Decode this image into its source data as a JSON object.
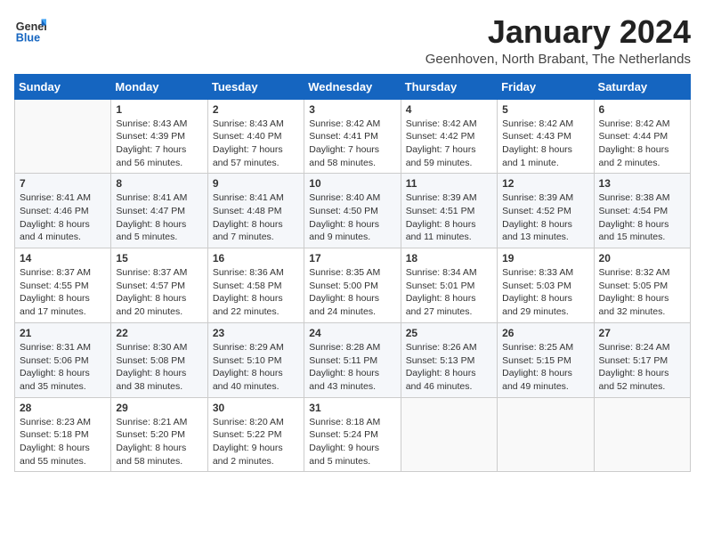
{
  "logo": {
    "line1": "General",
    "line2": "Blue"
  },
  "title": "January 2024",
  "subtitle": "Geenhoven, North Brabant, The Netherlands",
  "days_of_week": [
    "Sunday",
    "Monday",
    "Tuesday",
    "Wednesday",
    "Thursday",
    "Friday",
    "Saturday"
  ],
  "weeks": [
    [
      {
        "day": "",
        "info": ""
      },
      {
        "day": "1",
        "info": "Sunrise: 8:43 AM\nSunset: 4:39 PM\nDaylight: 7 hours\nand 56 minutes."
      },
      {
        "day": "2",
        "info": "Sunrise: 8:43 AM\nSunset: 4:40 PM\nDaylight: 7 hours\nand 57 minutes."
      },
      {
        "day": "3",
        "info": "Sunrise: 8:42 AM\nSunset: 4:41 PM\nDaylight: 7 hours\nand 58 minutes."
      },
      {
        "day": "4",
        "info": "Sunrise: 8:42 AM\nSunset: 4:42 PM\nDaylight: 7 hours\nand 59 minutes."
      },
      {
        "day": "5",
        "info": "Sunrise: 8:42 AM\nSunset: 4:43 PM\nDaylight: 8 hours\nand 1 minute."
      },
      {
        "day": "6",
        "info": "Sunrise: 8:42 AM\nSunset: 4:44 PM\nDaylight: 8 hours\nand 2 minutes."
      }
    ],
    [
      {
        "day": "7",
        "info": "Sunrise: 8:41 AM\nSunset: 4:46 PM\nDaylight: 8 hours\nand 4 minutes."
      },
      {
        "day": "8",
        "info": "Sunrise: 8:41 AM\nSunset: 4:47 PM\nDaylight: 8 hours\nand 5 minutes."
      },
      {
        "day": "9",
        "info": "Sunrise: 8:41 AM\nSunset: 4:48 PM\nDaylight: 8 hours\nand 7 minutes."
      },
      {
        "day": "10",
        "info": "Sunrise: 8:40 AM\nSunset: 4:50 PM\nDaylight: 8 hours\nand 9 minutes."
      },
      {
        "day": "11",
        "info": "Sunrise: 8:39 AM\nSunset: 4:51 PM\nDaylight: 8 hours\nand 11 minutes."
      },
      {
        "day": "12",
        "info": "Sunrise: 8:39 AM\nSunset: 4:52 PM\nDaylight: 8 hours\nand 13 minutes."
      },
      {
        "day": "13",
        "info": "Sunrise: 8:38 AM\nSunset: 4:54 PM\nDaylight: 8 hours\nand 15 minutes."
      }
    ],
    [
      {
        "day": "14",
        "info": "Sunrise: 8:37 AM\nSunset: 4:55 PM\nDaylight: 8 hours\nand 17 minutes."
      },
      {
        "day": "15",
        "info": "Sunrise: 8:37 AM\nSunset: 4:57 PM\nDaylight: 8 hours\nand 20 minutes."
      },
      {
        "day": "16",
        "info": "Sunrise: 8:36 AM\nSunset: 4:58 PM\nDaylight: 8 hours\nand 22 minutes."
      },
      {
        "day": "17",
        "info": "Sunrise: 8:35 AM\nSunset: 5:00 PM\nDaylight: 8 hours\nand 24 minutes."
      },
      {
        "day": "18",
        "info": "Sunrise: 8:34 AM\nSunset: 5:01 PM\nDaylight: 8 hours\nand 27 minutes."
      },
      {
        "day": "19",
        "info": "Sunrise: 8:33 AM\nSunset: 5:03 PM\nDaylight: 8 hours\nand 29 minutes."
      },
      {
        "day": "20",
        "info": "Sunrise: 8:32 AM\nSunset: 5:05 PM\nDaylight: 8 hours\nand 32 minutes."
      }
    ],
    [
      {
        "day": "21",
        "info": "Sunrise: 8:31 AM\nSunset: 5:06 PM\nDaylight: 8 hours\nand 35 minutes."
      },
      {
        "day": "22",
        "info": "Sunrise: 8:30 AM\nSunset: 5:08 PM\nDaylight: 8 hours\nand 38 minutes."
      },
      {
        "day": "23",
        "info": "Sunrise: 8:29 AM\nSunset: 5:10 PM\nDaylight: 8 hours\nand 40 minutes."
      },
      {
        "day": "24",
        "info": "Sunrise: 8:28 AM\nSunset: 5:11 PM\nDaylight: 8 hours\nand 43 minutes."
      },
      {
        "day": "25",
        "info": "Sunrise: 8:26 AM\nSunset: 5:13 PM\nDaylight: 8 hours\nand 46 minutes."
      },
      {
        "day": "26",
        "info": "Sunrise: 8:25 AM\nSunset: 5:15 PM\nDaylight: 8 hours\nand 49 minutes."
      },
      {
        "day": "27",
        "info": "Sunrise: 8:24 AM\nSunset: 5:17 PM\nDaylight: 8 hours\nand 52 minutes."
      }
    ],
    [
      {
        "day": "28",
        "info": "Sunrise: 8:23 AM\nSunset: 5:18 PM\nDaylight: 8 hours\nand 55 minutes."
      },
      {
        "day": "29",
        "info": "Sunrise: 8:21 AM\nSunset: 5:20 PM\nDaylight: 8 hours\nand 58 minutes."
      },
      {
        "day": "30",
        "info": "Sunrise: 8:20 AM\nSunset: 5:22 PM\nDaylight: 9 hours\nand 2 minutes."
      },
      {
        "day": "31",
        "info": "Sunrise: 8:18 AM\nSunset: 5:24 PM\nDaylight: 9 hours\nand 5 minutes."
      },
      {
        "day": "",
        "info": ""
      },
      {
        "day": "",
        "info": ""
      },
      {
        "day": "",
        "info": ""
      }
    ]
  ]
}
